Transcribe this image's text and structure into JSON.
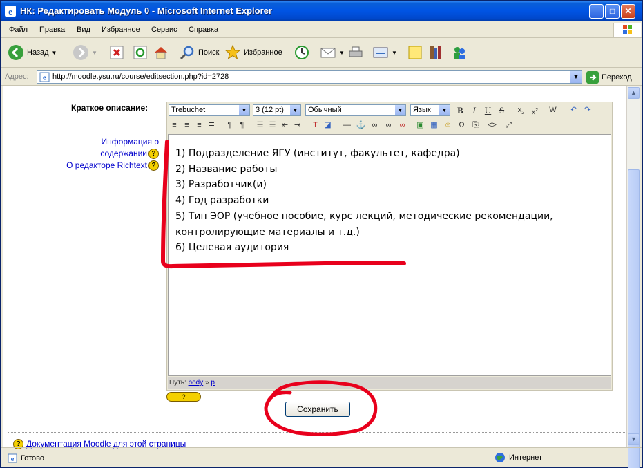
{
  "window": {
    "title": "НК: Редактировать Модуль 0 - Microsoft Internet Explorer",
    "controls": {
      "minimize": "_",
      "maximize": "□",
      "close": "✕"
    }
  },
  "menu": [
    "Файл",
    "Правка",
    "Вид",
    "Избранное",
    "Сервис",
    "Справка"
  ],
  "toolbar": {
    "back": "Назад",
    "search": "Поиск",
    "favorites": "Избранное"
  },
  "address": {
    "label": "Адрес:",
    "url": "http://moodle.ysu.ru/course/editsection.php?id=2728",
    "go": "Переход"
  },
  "form": {
    "desc_label": "Краткое описание:",
    "help_info_1": "Информация о",
    "help_info_2": "содержании",
    "help_richtext": "О редакторе Richtext",
    "save": "Сохранить",
    "docs_link": "Документация Moodle для этой страницы"
  },
  "editor": {
    "font": "Trebuchet",
    "size": "3 (12 pt)",
    "style": "Обычный",
    "lang": "Язык",
    "lines": [
      "1) Подразделение ЯГУ (институт, факультет, кафедра)",
      "2) Название работы",
      "3) Разработчик(и)",
      "4) Год разработки",
      "5) Тип ЭОР (учебное пособие, курс лекций, методические рекомендации,",
      "контролирующие материалы и т.д.)",
      "6) Целевая аудитория"
    ],
    "path_label": "Путь:",
    "path_body": "body",
    "path_sep": "»",
    "path_p": "p",
    "kbd_help": "?"
  },
  "status": {
    "text": "Готово",
    "zone": "Интернет"
  },
  "colors": {
    "annotation": "#e8001c",
    "titlebar": "#0054e3",
    "link": "#0000cc"
  }
}
